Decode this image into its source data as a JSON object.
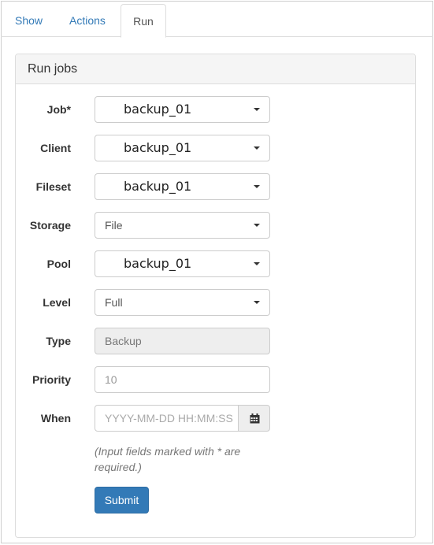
{
  "tabs": [
    {
      "label": "Show"
    },
    {
      "label": "Actions"
    },
    {
      "label": "Run",
      "active": true
    }
  ],
  "panel": {
    "title": "Run jobs"
  },
  "form": {
    "job": {
      "label": "Job*",
      "value": "backup_01"
    },
    "client": {
      "label": "Client",
      "value": "backup_01"
    },
    "fileset": {
      "label": "Fileset",
      "value": "backup_01"
    },
    "storage": {
      "label": "Storage",
      "value": "File"
    },
    "pool": {
      "label": "Pool",
      "value": "backup_01"
    },
    "level": {
      "label": "Level",
      "value": "Full"
    },
    "type": {
      "label": "Type",
      "value": "Backup"
    },
    "priority": {
      "label": "Priority",
      "value": "10"
    },
    "when": {
      "label": "When",
      "placeholder": "YYYY-MM-DD HH:MM:SS",
      "icon": "calendar-icon"
    },
    "hint": "(Input fields marked with * are required.)",
    "submit_label": "Submit"
  },
  "colors": {
    "primary": "#337ab7",
    "link": "#337ab7",
    "disabled_bg": "#eeeeee"
  }
}
